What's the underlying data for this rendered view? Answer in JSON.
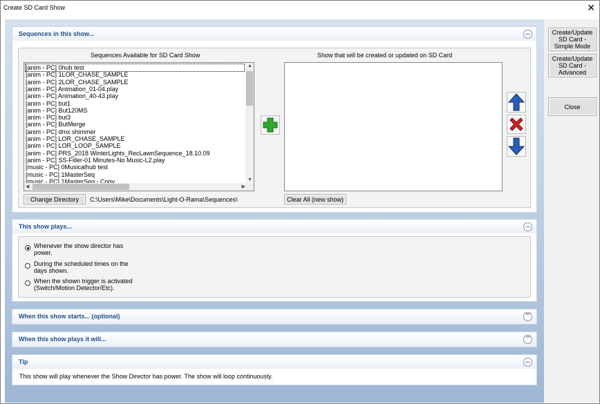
{
  "window": {
    "title": "Create SD Card Show",
    "close_glyph": "✕"
  },
  "side_buttons": {
    "simple_mode": "Create/Update SD Card - Simple Mode",
    "advanced": "Create/Update SD Card - Advanced",
    "close": "Close"
  },
  "sequences_panel": {
    "title": "Sequences in this show...",
    "available_label": "Sequences Available for SD Card Show",
    "show_label": "Show that will be created or updated on SD Card",
    "available_items": [
      "[anim  - PC] 0hub test",
      "[anim  - PC] 1LOR_CHASE_SAMPLE",
      "[anim  - PC] 2LOR_CHASE_SAMPLE",
      "[anim  - PC] Animation_01-04.play",
      "[anim  - PC] Animation_40-43.play",
      "[anim  - PC] but1",
      "[anim  - PC] But120MS",
      "[anim  - PC] but3",
      "[anim  - PC] ButMerge",
      "[anim  - PC] dmx shimmer",
      "[anim  - PC] LOR_CHASE_SAMPLE",
      "[anim  - PC] LOR_LOOP_SAMPLE",
      "[anim  - PC] PRS_2018 WinterLights_RecLawnSequence_18.10.09",
      "[anim  - PC] SS-Filler-01 Minutes-No Music-L2.play",
      "[music - PC] 0Musicalhub test",
      "[music - PC] 1MasterSeq",
      "[music - PC] 1MasterSeq - Copy"
    ],
    "change_directory": "Change Directory",
    "directory_path": "C:\\Users\\Mike\\Documents\\Light-O-Rama\\Sequences\\",
    "clear_all": "Clear All (new show)"
  },
  "plays_panel": {
    "title": "This show plays...",
    "options": [
      "Whenever the show director has power.",
      "During the scheduled times on the days shown.",
      "When the shown trigger is activated (Switch/Motion Detector/Etc)."
    ],
    "selected_index": 0
  },
  "starts_panel": {
    "title": "When this show starts... (optional)"
  },
  "will_panel": {
    "title": "When this show plays it will..."
  },
  "tip_panel": {
    "title": "Tip",
    "text": "This show will play whenever the Show Director has power.  The show will loop continuously."
  },
  "icons": {
    "add": "plus-icon",
    "up": "up-arrow-icon",
    "remove": "x-icon",
    "down": "down-arrow-icon",
    "collapse": "chevron-up-icon",
    "expand": "chevron-down-icon"
  },
  "colors": {
    "accent": "#1f4e8c",
    "add": "#2ea82e",
    "remove": "#d42020",
    "arrow": "#2a5fb8"
  }
}
